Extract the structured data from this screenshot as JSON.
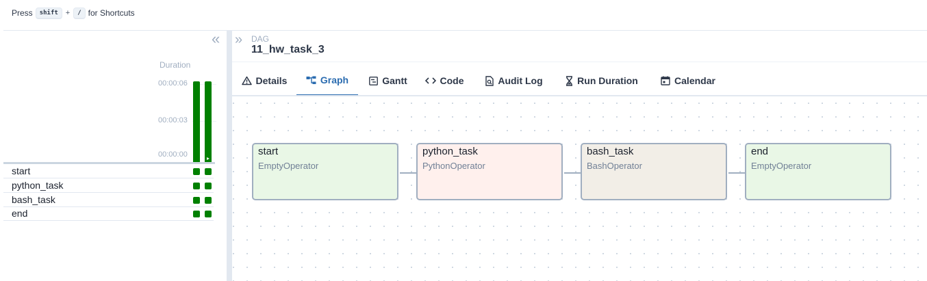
{
  "shortcuts": {
    "prefix": "Press",
    "key1": "shift",
    "plus": "+",
    "key2": "/",
    "suffix": "for Shortcuts"
  },
  "grid": {
    "duration_label": "Duration",
    "ticks": [
      "00:00:06",
      "00:00:03",
      "00:00:00"
    ],
    "bars": [
      {
        "duration_seconds": 6.6,
        "color": "#008000"
      },
      {
        "duration_seconds": 6.6,
        "color": "#008000",
        "selected": true
      }
    ],
    "tasks": [
      {
        "name": "start",
        "states": [
          "success",
          "success"
        ]
      },
      {
        "name": "python_task",
        "states": [
          "success",
          "success"
        ]
      },
      {
        "name": "bash_task",
        "states": [
          "success",
          "success"
        ]
      },
      {
        "name": "end",
        "states": [
          "success",
          "success"
        ]
      }
    ]
  },
  "header": {
    "label": "DAG",
    "dag_id": "11_hw_task_3"
  },
  "tabs": [
    {
      "label": "Details",
      "icon": "warning-triangle-icon"
    },
    {
      "label": "Graph",
      "icon": "graph-icon",
      "active": true
    },
    {
      "label": "Gantt",
      "icon": "gantt-icon"
    },
    {
      "label": "Code",
      "icon": "code-icon"
    },
    {
      "label": "Audit Log",
      "icon": "audit-log-icon"
    },
    {
      "label": "Run Duration",
      "icon": "hourglass-icon"
    },
    {
      "label": "Calendar",
      "icon": "calendar-icon"
    }
  ],
  "graph": {
    "nodes": [
      {
        "id": "start",
        "operator": "EmptyOperator",
        "color": "#e9f7e6"
      },
      {
        "id": "python_task",
        "operator": "PythonOperator",
        "color": "#fff0ed"
      },
      {
        "id": "bash_task",
        "operator": "BashOperator",
        "color": "#f2eee7"
      },
      {
        "id": "end",
        "operator": "EmptyOperator",
        "color": "#e9f7e6"
      }
    ]
  },
  "colors": {
    "success": "#008000",
    "accent": "#2b6cb0",
    "border": "#a0aec0"
  }
}
